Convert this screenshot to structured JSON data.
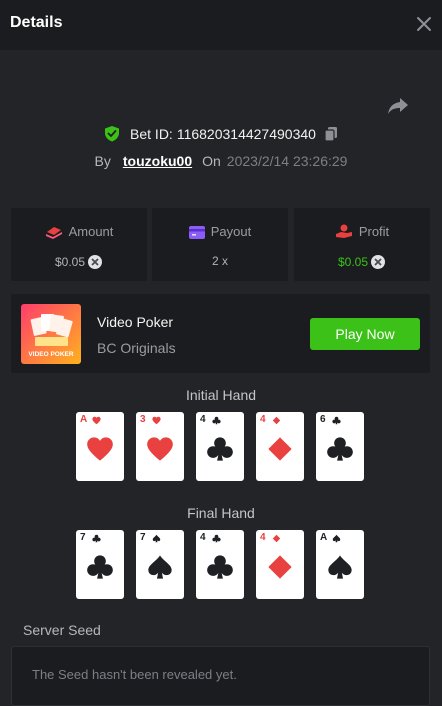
{
  "header": {
    "title": "Details"
  },
  "bet": {
    "id_label": "Bet ID:",
    "id_value": "116820314427490340",
    "by_label": "By",
    "username": "touzoku00",
    "on_label": "On",
    "date": "2023/2/14 23:26:29"
  },
  "stats": {
    "amount": {
      "label": "Amount",
      "value": "$0.05"
    },
    "payout": {
      "label": "Payout",
      "value": "2 x"
    },
    "profit": {
      "label": "Profit",
      "value": "$0.05"
    }
  },
  "game": {
    "thumb_text": "VIDEO POKER",
    "name": "Video Poker",
    "provider": "BC Originals",
    "play_label": "Play Now"
  },
  "initial_hand": {
    "title": "Initial Hand",
    "cards": [
      {
        "rank": "A",
        "suit": "heart"
      },
      {
        "rank": "3",
        "suit": "heart"
      },
      {
        "rank": "4",
        "suit": "club"
      },
      {
        "rank": "4",
        "suit": "diamond"
      },
      {
        "rank": "6",
        "suit": "club"
      }
    ]
  },
  "final_hand": {
    "title": "Final Hand",
    "cards": [
      {
        "rank": "7",
        "suit": "club"
      },
      {
        "rank": "7",
        "suit": "spade"
      },
      {
        "rank": "4",
        "suit": "club"
      },
      {
        "rank": "4",
        "suit": "diamond"
      },
      {
        "rank": "A",
        "suit": "spade"
      }
    ]
  },
  "seed": {
    "title": "Server Seed",
    "message": "The Seed hasn't been revealed yet."
  },
  "colors": {
    "background": "#232427",
    "panel": "#1b1c1f",
    "accent_green": "#3bc117",
    "card_red": "#e9413f"
  }
}
